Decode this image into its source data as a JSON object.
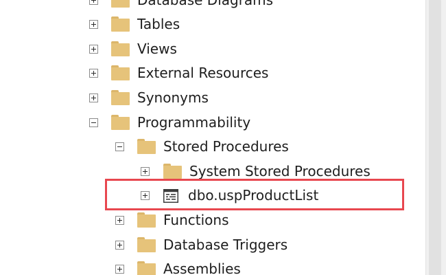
{
  "tree": {
    "items": [
      {
        "label": "Database Diagrams",
        "expander": "plus",
        "icon": "folder-icon"
      },
      {
        "label": "Tables",
        "expander": "plus",
        "icon": "folder-icon"
      },
      {
        "label": "Views",
        "expander": "plus",
        "icon": "folder-icon"
      },
      {
        "label": "External Resources",
        "expander": "plus",
        "icon": "folder-icon"
      },
      {
        "label": "Synonyms",
        "expander": "plus",
        "icon": "folder-icon"
      },
      {
        "label": "Programmability",
        "expander": "minus",
        "icon": "folder-icon"
      },
      {
        "label": "Stored Procedures",
        "expander": "minus",
        "icon": "folder-icon"
      },
      {
        "label": "System Stored Procedures",
        "expander": "plus",
        "icon": "folder-icon"
      },
      {
        "label": "dbo.uspProductList",
        "expander": "plus",
        "icon": "stored-procedure-icon",
        "highlighted": true
      },
      {
        "label": "Functions",
        "expander": "plus",
        "icon": "folder-icon"
      },
      {
        "label": "Database Triggers",
        "expander": "plus",
        "icon": "folder-icon"
      },
      {
        "label": "Assemblies",
        "expander": "plus",
        "icon": "folder-icon"
      }
    ]
  },
  "colors": {
    "highlight_border": "#e8474f",
    "folder": "#e6c37a",
    "text": "#1e1e1e"
  }
}
